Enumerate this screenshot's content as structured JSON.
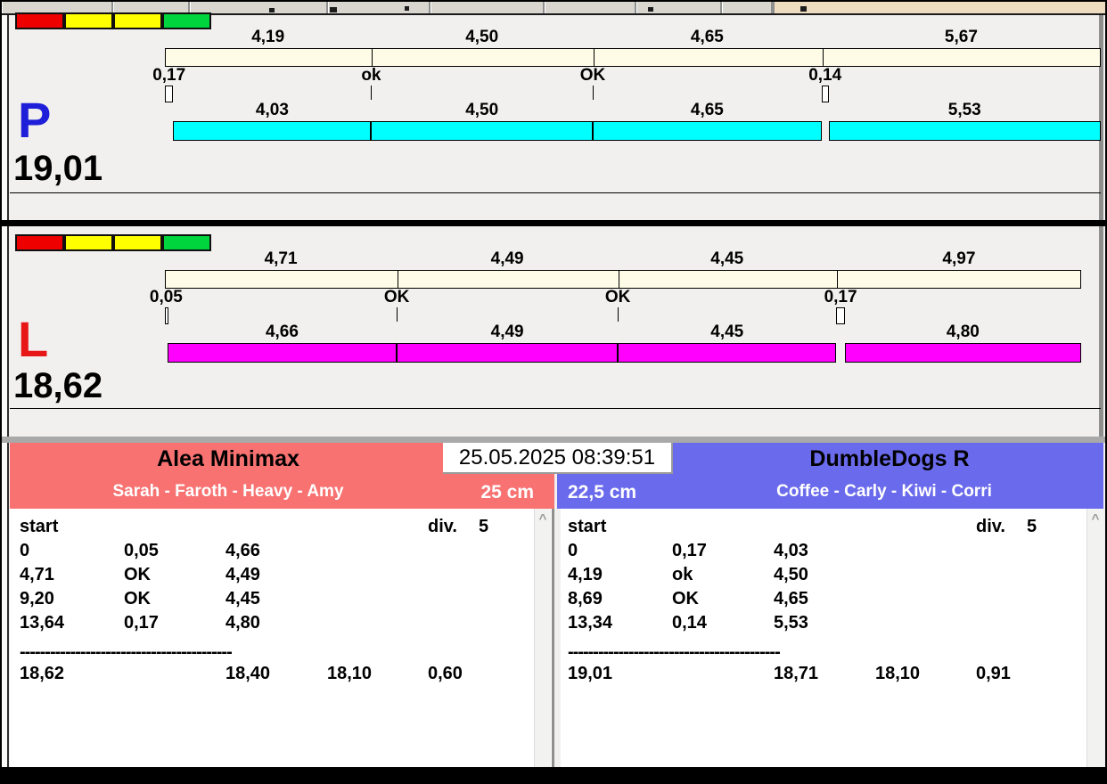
{
  "colors": {
    "toolbar_tan": "#eedcc0",
    "cream_bar": "#fefce6",
    "cyan_bar": "#00ffff",
    "magenta_bar": "#ff00ff",
    "status_red": "#ee0000",
    "status_yellow": "#ffff00",
    "status_green": "#00d53e",
    "team_left_bg": "#f87272",
    "team_right_bg": "#6a6aec"
  },
  "icons": {
    "scroll_up": "^"
  },
  "clock": "25.05.2025 08:39:51",
  "panels": [
    {
      "side_label": "P",
      "side_label_color": "#1f1fd9",
      "total_label": "19,01",
      "total_value": 19.01,
      "status_blocks": [
        "#ee0000",
        "#ffff00",
        "#ffff00",
        "#00d53e"
      ],
      "top_bar": {
        "boundaries": [
          0,
          4.19,
          8.69,
          13.34,
          19.01
        ],
        "labels": [
          "4,19",
          "4,50",
          "4,65",
          "5,67"
        ]
      },
      "markers": [
        {
          "label": "0,17",
          "at": 0,
          "type": "box",
          "width": 0.17
        },
        {
          "label": "ok",
          "at": 4.19,
          "type": "tick"
        },
        {
          "label": "OK",
          "at": 8.69,
          "type": "tick"
        },
        {
          "label": "0,14",
          "at": 13.34,
          "type": "box",
          "width": 0.14
        }
      ],
      "bottom_bar": {
        "color": "#00ffff",
        "segments": [
          {
            "label": "4,03",
            "from": 0.17,
            "to": 4.19
          },
          {
            "label": "4,50",
            "from": 4.19,
            "to": 8.69
          },
          {
            "label": "4,65",
            "from": 8.69,
            "to": 13.34
          },
          {
            "label": "5,53",
            "from": 13.48,
            "to": 19.01
          }
        ]
      }
    },
    {
      "side_label": "L",
      "side_label_color": "#e81717",
      "total_label": "18,62",
      "total_value": 18.62,
      "status_blocks": [
        "#ee0000",
        "#ffff00",
        "#ffff00",
        "#00d53e"
      ],
      "top_bar": {
        "boundaries": [
          0,
          4.71,
          9.2,
          13.64,
          18.62
        ],
        "labels": [
          "4,71",
          "4,49",
          "4,45",
          "4,97"
        ]
      },
      "markers": [
        {
          "label": "0,05",
          "at": 0,
          "type": "box",
          "width": 0.05
        },
        {
          "label": "OK",
          "at": 4.71,
          "type": "tick"
        },
        {
          "label": "OK",
          "at": 9.2,
          "type": "tick"
        },
        {
          "label": "0,17",
          "at": 13.64,
          "type": "box",
          "width": 0.17
        }
      ],
      "bottom_bar": {
        "color": "#ff00ff",
        "segments": [
          {
            "label": "4,66",
            "from": 0.05,
            "to": 4.71
          },
          {
            "label": "4,49",
            "from": 4.71,
            "to": 9.2
          },
          {
            "label": "4,45",
            "from": 9.2,
            "to": 13.64
          },
          {
            "label": "4,80",
            "from": 13.81,
            "to": 18.61
          }
        ]
      }
    }
  ],
  "teams": [
    {
      "name": "Alea Minimax",
      "dogs": "Sarah - Faroth - Heavy - Amy",
      "height": "25 cm",
      "bg": "#f87272",
      "table": {
        "start_label": "start",
        "div_label": "div.",
        "div_value": "5",
        "rows": [
          [
            "0",
            "0,05",
            "4,66"
          ],
          [
            "4,71",
            "OK",
            "4,49"
          ],
          [
            "9,20",
            "OK",
            "4,45"
          ],
          [
            "13,64",
            "0,17",
            "4,80"
          ]
        ],
        "separator": "------------------------------------------",
        "totals": [
          "18,62",
          "18,40",
          "18,10",
          "0,60"
        ]
      }
    },
    {
      "name": "DumbleDogs R",
      "dogs": "Coffee - Carly - Kiwi - Corri",
      "height": "22,5 cm",
      "bg": "#6a6aec",
      "table": {
        "start_label": "start",
        "div_label": "div.",
        "div_value": "5",
        "rows": [
          [
            "0",
            "0,17",
            "4,03"
          ],
          [
            "4,19",
            "ok",
            "4,50"
          ],
          [
            "8,69",
            "OK",
            "4,65"
          ],
          [
            "13,34",
            "0,14",
            "5,53"
          ]
        ],
        "separator": "------------------------------------------",
        "totals": [
          "19,01",
          "18,71",
          "18,10",
          "0,91"
        ]
      }
    }
  ]
}
